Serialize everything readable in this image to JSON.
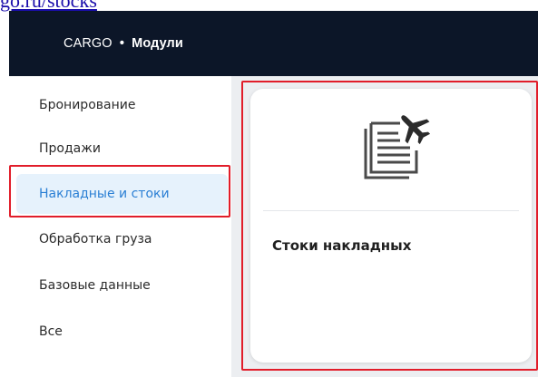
{
  "browser": {
    "url_fragment": "go.ru/stocks"
  },
  "header": {
    "brand": "CARGO",
    "separator": "•",
    "module": "Модули"
  },
  "sidebar": {
    "items": [
      {
        "label": "Бронирование"
      },
      {
        "label": "Продажи"
      },
      {
        "label": "Накладные и стоки",
        "active": true
      },
      {
        "label": "Обработка груза"
      },
      {
        "label": "Базовые данные"
      },
      {
        "label": "Все"
      }
    ]
  },
  "main": {
    "card": {
      "icon": "waybill-airplane-icon",
      "title": "Стоки накладных"
    }
  },
  "colors": {
    "header_bg": "#0c1628",
    "active_bg": "#e6f2fc",
    "active_text": "#2a7fd4",
    "highlight": "#e11d2a",
    "content_bg": "#eceef1"
  }
}
